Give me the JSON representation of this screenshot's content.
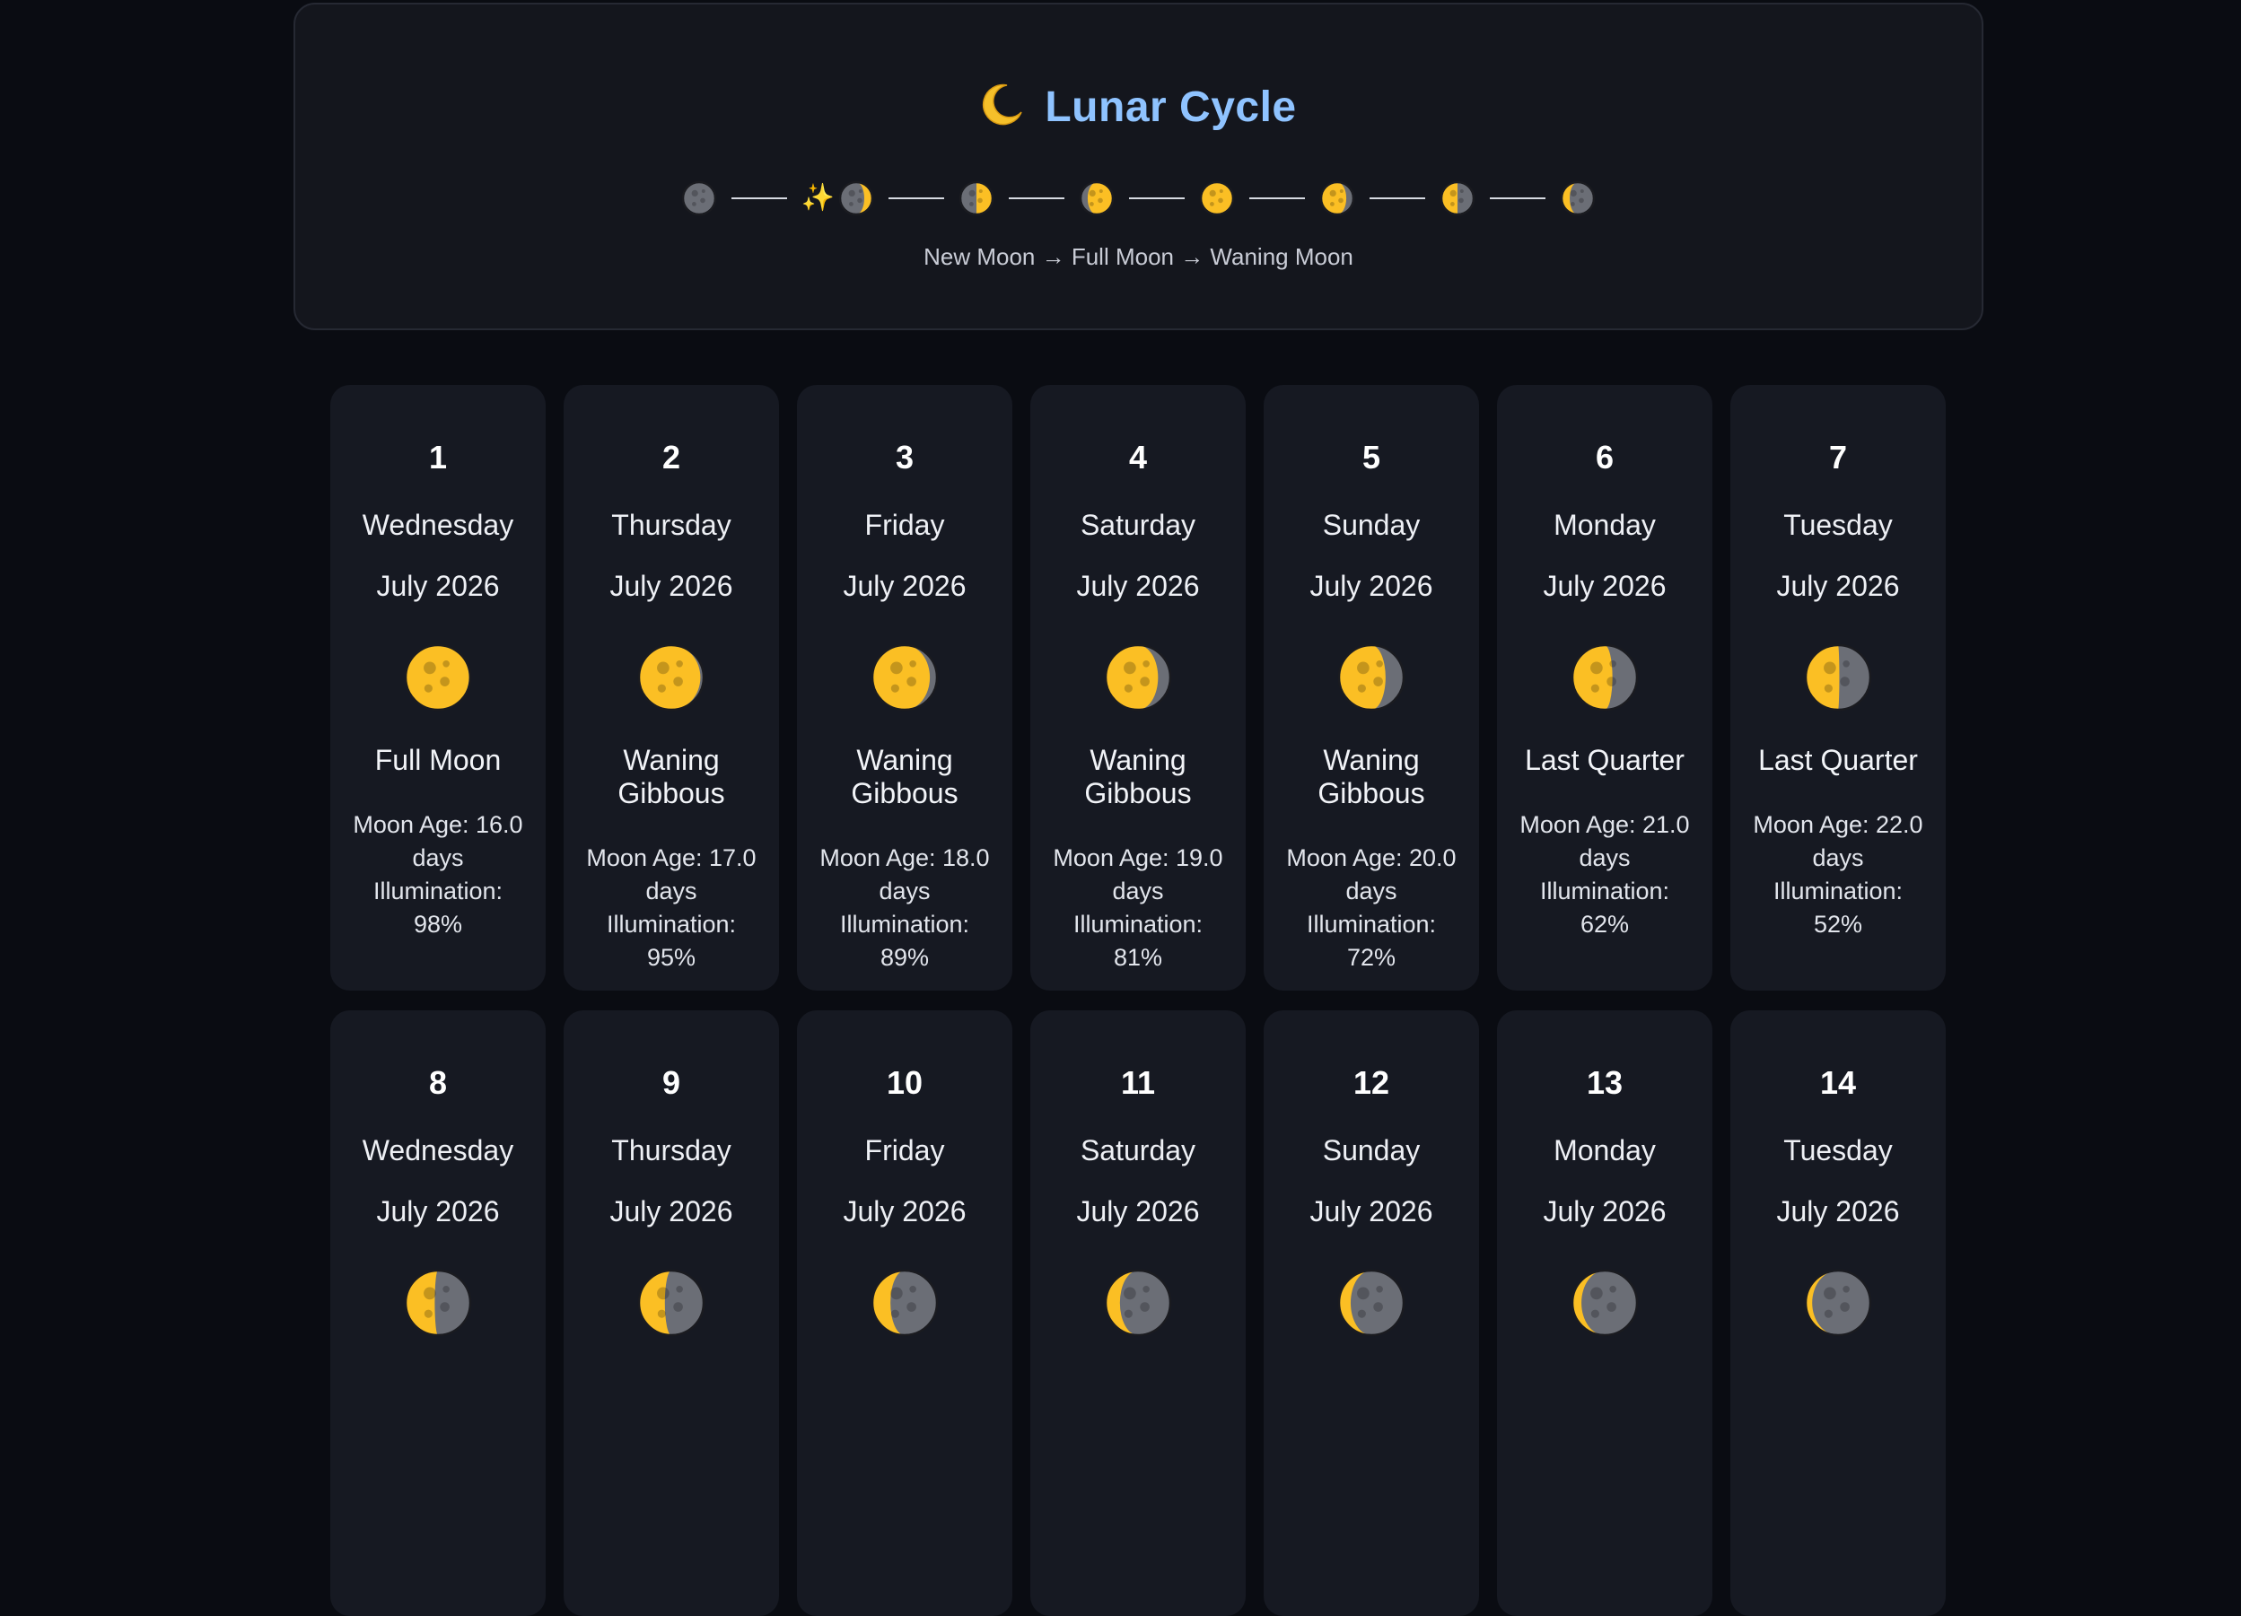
{
  "header": {
    "title": "Lunar Cycle",
    "title_icon": "crescent-moon-icon",
    "cycle_icons": [
      "new-moon",
      "sparkle",
      "waxing-crescent",
      "first-quarter",
      "waxing-gibbous",
      "full-moon",
      "waning-gibbous",
      "last-quarter",
      "waning-crescent"
    ],
    "subtitle": "New Moon → Full Moon → Waning Moon"
  },
  "colors": {
    "background": "#0a0c12",
    "panel": "#14161d",
    "card": "#161922",
    "accent": "#8fc3ff",
    "moon_lit": "#fbbf24",
    "moon_dark": "#6b6e76"
  },
  "days": [
    {
      "day": "1",
      "weekday": "Wednesday",
      "month": "July 2026",
      "phase": "Full Moon",
      "age_label": "Moon Age: 16.0 days",
      "illum_label": "Illumination: 98%",
      "illumination": 98,
      "waning": true
    },
    {
      "day": "2",
      "weekday": "Thursday",
      "month": "July 2026",
      "phase": "Waning Gibbous",
      "age_label": "Moon Age: 17.0 days",
      "illum_label": "Illumination: 95%",
      "illumination": 95,
      "waning": true
    },
    {
      "day": "3",
      "weekday": "Friday",
      "month": "July 2026",
      "phase": "Waning Gibbous",
      "age_label": "Moon Age: 18.0 days",
      "illum_label": "Illumination: 89%",
      "illumination": 89,
      "waning": true
    },
    {
      "day": "4",
      "weekday": "Saturday",
      "month": "July 2026",
      "phase": "Waning Gibbous",
      "age_label": "Moon Age: 19.0 days",
      "illum_label": "Illumination: 81%",
      "illumination": 81,
      "waning": true
    },
    {
      "day": "5",
      "weekday": "Sunday",
      "month": "July 2026",
      "phase": "Waning Gibbous",
      "age_label": "Moon Age: 20.0 days",
      "illum_label": "Illumination: 72%",
      "illumination": 72,
      "waning": true
    },
    {
      "day": "6",
      "weekday": "Monday",
      "month": "July 2026",
      "phase": "Last Quarter",
      "age_label": "Moon Age: 21.0 days",
      "illum_label": "Illumination: 62%",
      "illumination": 62,
      "waning": true
    },
    {
      "day": "7",
      "weekday": "Tuesday",
      "month": "July 2026",
      "phase": "Last Quarter",
      "age_label": "Moon Age: 22.0 days",
      "illum_label": "Illumination: 52%",
      "illumination": 52,
      "waning": true
    },
    {
      "day": "8",
      "weekday": "Wednesday",
      "month": "July 2026",
      "phase": "",
      "age_label": "",
      "illum_label": "",
      "illumination": 45,
      "waning": true
    },
    {
      "day": "9",
      "weekday": "Thursday",
      "month": "July 2026",
      "phase": "",
      "age_label": "",
      "illum_label": "",
      "illumination": 40,
      "waning": true
    },
    {
      "day": "10",
      "weekday": "Friday",
      "month": "July 2026",
      "phase": "",
      "age_label": "",
      "illum_label": "",
      "illumination": 28,
      "waning": true
    },
    {
      "day": "11",
      "weekday": "Saturday",
      "month": "July 2026",
      "phase": "",
      "age_label": "",
      "illum_label": "",
      "illumination": 22,
      "waning": true
    },
    {
      "day": "12",
      "weekday": "Sunday",
      "month": "July 2026",
      "phase": "",
      "age_label": "",
      "illum_label": "",
      "illumination": 18,
      "waning": true
    },
    {
      "day": "13",
      "weekday": "Monday",
      "month": "July 2026",
      "phase": "",
      "age_label": "",
      "illum_label": "",
      "illumination": 14,
      "waning": true
    },
    {
      "day": "14",
      "weekday": "Tuesday",
      "month": "July 2026",
      "phase": "",
      "age_label": "",
      "illum_label": "",
      "illumination": 10,
      "waning": true
    }
  ]
}
